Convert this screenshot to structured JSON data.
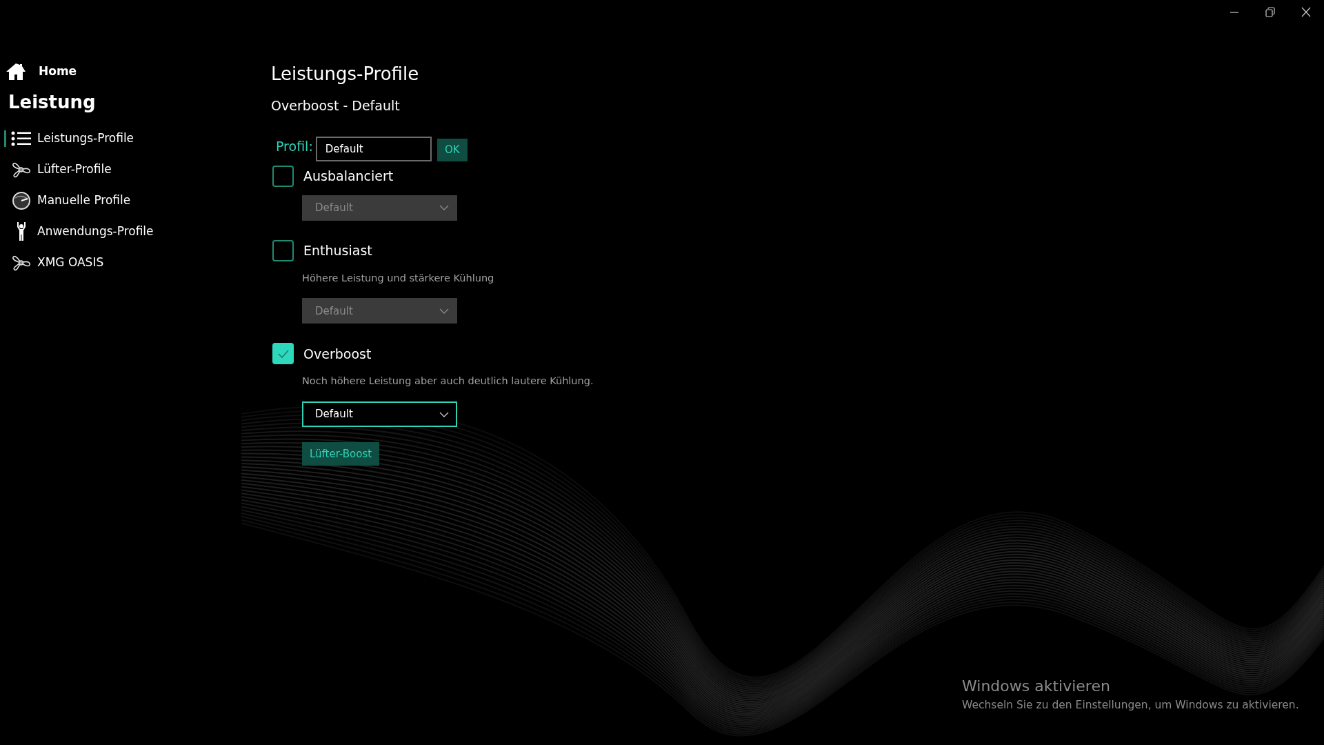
{
  "sidebar": {
    "home": "Home",
    "section": "Leistung",
    "items": [
      {
        "label": "Leistungs-Profile",
        "kind": "list",
        "selected": true
      },
      {
        "label": "Lüfter-Profile",
        "kind": "fan",
        "selected": false
      },
      {
        "label": "Manuelle Profile",
        "kind": "gauge",
        "selected": false
      },
      {
        "label": "Anwendungs-Profile",
        "kind": "person",
        "selected": false
      },
      {
        "label": "XMG OASIS",
        "kind": "fan",
        "selected": false
      }
    ]
  },
  "main": {
    "title": "Leistungs-Profile",
    "subtitle": "Overboost - Default",
    "profile": {
      "label": "Profil:",
      "value": "Default",
      "button": "OK"
    },
    "modes": [
      {
        "label": "Ausbalanciert",
        "checked": false,
        "dropdown": {
          "value": "Default",
          "disabled": true
        }
      },
      {
        "label": "Enthusiast",
        "checked": false,
        "description": "Höhere Leistung und stärkere Kühlung",
        "dropdown": {
          "value": "Default",
          "disabled": true
        }
      },
      {
        "label": "Overboost",
        "checked": true,
        "description": "Noch höhere Leistung aber auch deutlich lautere Kühlung.",
        "dropdown": {
          "value": "Default",
          "disabled": false
        }
      }
    ],
    "fan_boost_button": "Lüfter-Boost"
  },
  "activation_notice": {
    "title": "Windows aktivieren",
    "text": "Wechseln Sie zu den Einstellungen, um Windows zu aktivieren."
  }
}
